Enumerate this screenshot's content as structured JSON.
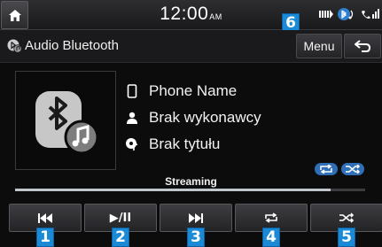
{
  "status_bar": {
    "time": "12:00",
    "am_pm": "AM",
    "icons": [
      "home-icon",
      "signal-strength-icon",
      "bluetooth-audio-icon",
      "phone-signal-icon"
    ]
  },
  "header": {
    "title": "Audio Bluetooth",
    "title_icon": "bluetooth-audio-icon",
    "menu_label": "Menu",
    "back_icon": "back-arrow-icon"
  },
  "track": {
    "album_art_icon": "bluetooth-music-icon",
    "phone_name": "Phone Name",
    "artist": "Brak wykonawcy",
    "title": "Brak tytułu",
    "status": "Streaming",
    "progress_fraction": 0.9,
    "mode_badges": [
      "repeat-icon",
      "shuffle-icon"
    ]
  },
  "controls": [
    {
      "name": "previous-track-button",
      "icon": "skip-previous-icon"
    },
    {
      "name": "play-pause-button",
      "icon": "play-pause-icon",
      "label": "▶/II"
    },
    {
      "name": "next-track-button",
      "icon": "skip-next-icon"
    },
    {
      "name": "repeat-button",
      "icon": "repeat-icon"
    },
    {
      "name": "shuffle-button",
      "icon": "shuffle-icon"
    }
  ],
  "callouts": {
    "c1": "1",
    "c2": "2",
    "c3": "3",
    "c4": "4",
    "c5": "5",
    "c6": "6"
  },
  "colors": {
    "accent": "#1b8ad6",
    "badge": "#2f6fb8",
    "background": "#0c0c0d"
  }
}
